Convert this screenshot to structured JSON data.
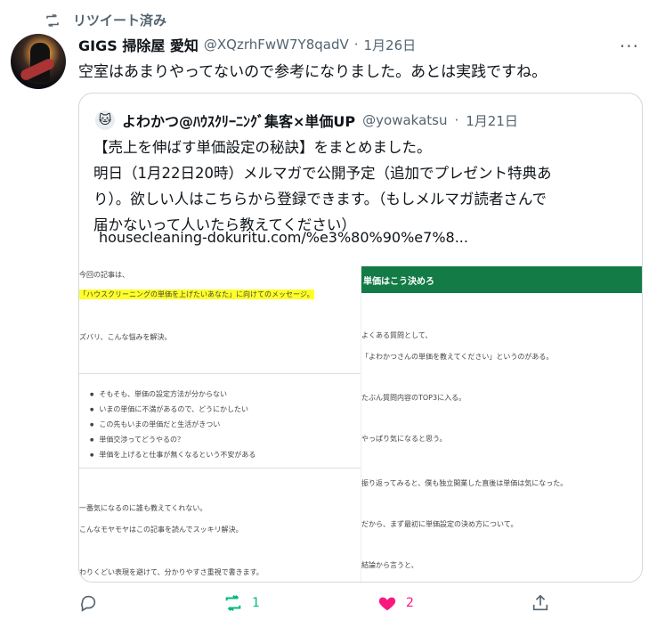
{
  "retweet_bar": {
    "label": "リツイート済み"
  },
  "tweet": {
    "display_name": "GIGS 掃除屋 愛知",
    "handle": "@XQzrhFwW7Y8qadV",
    "separator": "·",
    "date": "1月26日",
    "more_label": "···",
    "text": "空室はあまりやってないので参考になりました。あとは実践ですね。"
  },
  "quote": {
    "avatar_emoji": "🐱",
    "display_name": "よわかつ@ﾊｳｽｸﾘｰﾆﾝｸﾞ集客×単価UP",
    "handle": "@yowakatsu",
    "separator": "·",
    "date": "1月21日",
    "lines": [
      "【売上を伸ばす単価設定の秘訣】をまとめました。",
      "明日（1月22日20時）メルマガで公開予定（追加でプレゼント特典あ",
      "り）。欲しい人はこちらから登録できます。（もしメルマガ読者さんで",
      "届かないって人いたら教えてください）"
    ],
    "link": "housecleaning-dokuritu.com/%e3%80%90%e7%8..."
  },
  "media": {
    "left": {
      "l1": "今回の記事は、",
      "l2": "「ハウスクリーニングの単価を上げたいあなた」に向けてのメッセージ。",
      "l3": "ズバリ、こんな悩みを解決。",
      "bullets": [
        "そもそも、単価の設定方法が分からない",
        "いまの単価に不満があるので、どうにかしたい",
        "この先もいまの単価だと生活がきつい",
        "単価交渉ってどうやるの？",
        "単価を上げると仕事が無くなるという不安がある"
      ],
      "l4": "一番気になるのに誰も教えてくれない。",
      "l5": "こんなモヤモヤはこの記事を読んでスッキリ解決。",
      "l6": "わりくどい表現を避けて、分かりやすさ重視で書きます。"
    },
    "right": {
      "heading": "単価はこう決めろ",
      "r1": "よくある質問として、",
      "r2": "「よわかつさんの単価を教えてください」というのがある。",
      "r3": "たぶん質問内容のTOP3に入る。",
      "r4": "やっぱり気になると思う。",
      "r5": "振り返ってみると、僕も独立開業した直後は単価は気になった。",
      "r6": "だから、まず最初に単価設定の決め方について。",
      "r7": "結論から言うと、"
    }
  },
  "actions": {
    "reply_count": "",
    "retweet_count": "1",
    "like_count": "2",
    "colors": {
      "retweet": "#00ba7c",
      "like": "#f91880",
      "muted": "#536471"
    }
  }
}
